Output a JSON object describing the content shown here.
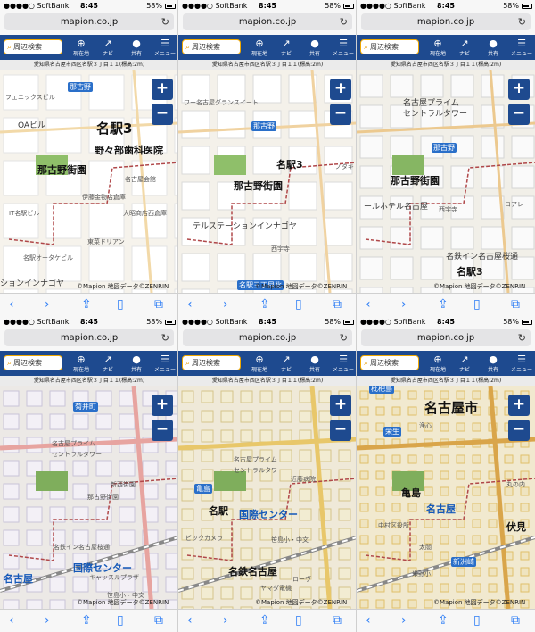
{
  "status": {
    "carrier": "●●●●○ SoftBank",
    "time": "8:45",
    "battery": "58%"
  },
  "browser": {
    "url": "mapion.co.jp",
    "reload_icon": "reload-icon"
  },
  "toolbar": {
    "search_label": "周辺検索",
    "tools": [
      {
        "label": "現在地",
        "icon": "crosshair-icon"
      },
      {
        "label": "ナビ",
        "icon": "route-icon"
      },
      {
        "label": "共有",
        "icon": "speech-bubble-icon"
      },
      {
        "label": "メニュー",
        "icon": "menu-icon"
      }
    ]
  },
  "address": "愛知県名古屋市西区名駅３丁目１１(標高:2m)",
  "zoom": {
    "in": "+",
    "out": "−"
  },
  "copyright": {
    "mark": "©Mapion",
    "text": " 地図データ©ZENRIN"
  },
  "bottom_nav": [
    {
      "name": "back",
      "glyph": "‹"
    },
    {
      "name": "forward",
      "glyph": "›"
    },
    {
      "name": "share",
      "glyph": "⇪"
    },
    {
      "name": "bookmarks",
      "glyph": "▯"
    },
    {
      "name": "tabs",
      "glyph": "⧉"
    }
  ],
  "panels": [
    {
      "zoom_level": 1,
      "labels": [
        {
          "text": "名駅3",
          "cls": "big"
        },
        {
          "text": "野々部歯科医院",
          "cls": "mid"
        },
        {
          "text": "那古野街園",
          "cls": "mid"
        },
        {
          "text": "那古野",
          "cls": "station"
        },
        {
          "text": "OAビル",
          "cls": ""
        },
        {
          "text": "フェニックスビル",
          "cls": "sm"
        },
        {
          "text": "名古屋会館",
          "cls": "sm"
        },
        {
          "text": "伊藤金物店倉庫",
          "cls": "sm"
        },
        {
          "text": "大昭商店西倉庫",
          "cls": "sm"
        },
        {
          "text": "IT名駅ビル",
          "cls": "sm"
        },
        {
          "text": "東菜ドリアン",
          "cls": "sm"
        },
        {
          "text": "名駅オータケビル",
          "cls": "sm"
        },
        {
          "text": "ションインナゴヤ",
          "cls": ""
        }
      ]
    },
    {
      "zoom_level": 2,
      "labels": [
        {
          "text": "那古野",
          "cls": "station"
        },
        {
          "text": "ワー名古屋グランスイート",
          "cls": "sm"
        },
        {
          "text": "名駅3",
          "cls": "mid"
        },
        {
          "text": "那古野街園",
          "cls": "mid"
        },
        {
          "text": "テルステーションインナゴヤ",
          "cls": ""
        },
        {
          "text": "西宇寺",
          "cls": "sm"
        },
        {
          "text": "名駅三丁目北",
          "cls": "station"
        },
        {
          "text": "ノタキ",
          "cls": "sm"
        }
      ]
    },
    {
      "zoom_level": 3,
      "labels": [
        {
          "text": "名古屋プライム",
          "cls": ""
        },
        {
          "text": "セントラルタワー",
          "cls": ""
        },
        {
          "text": "那古野",
          "cls": "station"
        },
        {
          "text": "那古野街園",
          "cls": "mid"
        },
        {
          "text": "ールホテル名古屋",
          "cls": ""
        },
        {
          "text": "西宇寺",
          "cls": "sm"
        },
        {
          "text": "名鉄イン名古屋桜通",
          "cls": ""
        },
        {
          "text": "名駅3",
          "cls": "mid"
        },
        {
          "text": "那古野",
          "cls": "station"
        },
        {
          "text": "コアレ",
          "cls": "sm"
        }
      ]
    },
    {
      "zoom_level": 4,
      "labels": [
        {
          "text": "菊井町",
          "cls": "station"
        },
        {
          "text": "名古屋プライム",
          "cls": "sm"
        },
        {
          "text": "セントラルタワー",
          "cls": "sm"
        },
        {
          "text": "新西街園",
          "cls": "sm"
        },
        {
          "text": "那古野街園",
          "cls": "sm"
        },
        {
          "text": "国際センター",
          "cls": "mid blue"
        },
        {
          "text": "キャッスルプラザ",
          "cls": "sm"
        },
        {
          "text": "名古屋",
          "cls": "mid blue"
        },
        {
          "text": "名鉄イン名古屋桜通",
          "cls": "sm"
        },
        {
          "text": "笹島小・中文",
          "cls": "sm"
        }
      ]
    },
    {
      "zoom_level": 5,
      "labels": [
        {
          "text": "亀島",
          "cls": "station"
        },
        {
          "text": "名古屋プライム",
          "cls": "sm"
        },
        {
          "text": "セントラルタワー",
          "cls": "sm"
        },
        {
          "text": "近藤病院",
          "cls": "sm"
        },
        {
          "text": "名駅",
          "cls": "mid"
        },
        {
          "text": "国際センター",
          "cls": "mid blue"
        },
        {
          "text": "ビックカメラ",
          "cls": "sm"
        },
        {
          "text": "名鉄名古屋",
          "cls": "mid"
        },
        {
          "text": "笹島小・中文",
          "cls": "sm"
        },
        {
          "text": "ヤマダ電機",
          "cls": "sm"
        },
        {
          "text": "ローヴ",
          "cls": "sm"
        }
      ]
    },
    {
      "zoom_level": 6,
      "labels": [
        {
          "text": "名古屋市",
          "cls": "big"
        },
        {
          "text": "浄心",
          "cls": "sm"
        },
        {
          "text": "枇杷島",
          "cls": "station"
        },
        {
          "text": "栄生",
          "cls": "station"
        },
        {
          "text": "亀島",
          "cls": "mid"
        },
        {
          "text": "名古屋",
          "cls": "mid blue"
        },
        {
          "text": "中村区役所",
          "cls": "sm"
        },
        {
          "text": "太閤",
          "cls": "sm"
        },
        {
          "text": "伏見",
          "cls": "mid"
        },
        {
          "text": "丸の内",
          "cls": "sm"
        },
        {
          "text": "新洲崎",
          "cls": "station"
        },
        {
          "text": "米野小",
          "cls": "sm"
        }
      ]
    }
  ]
}
